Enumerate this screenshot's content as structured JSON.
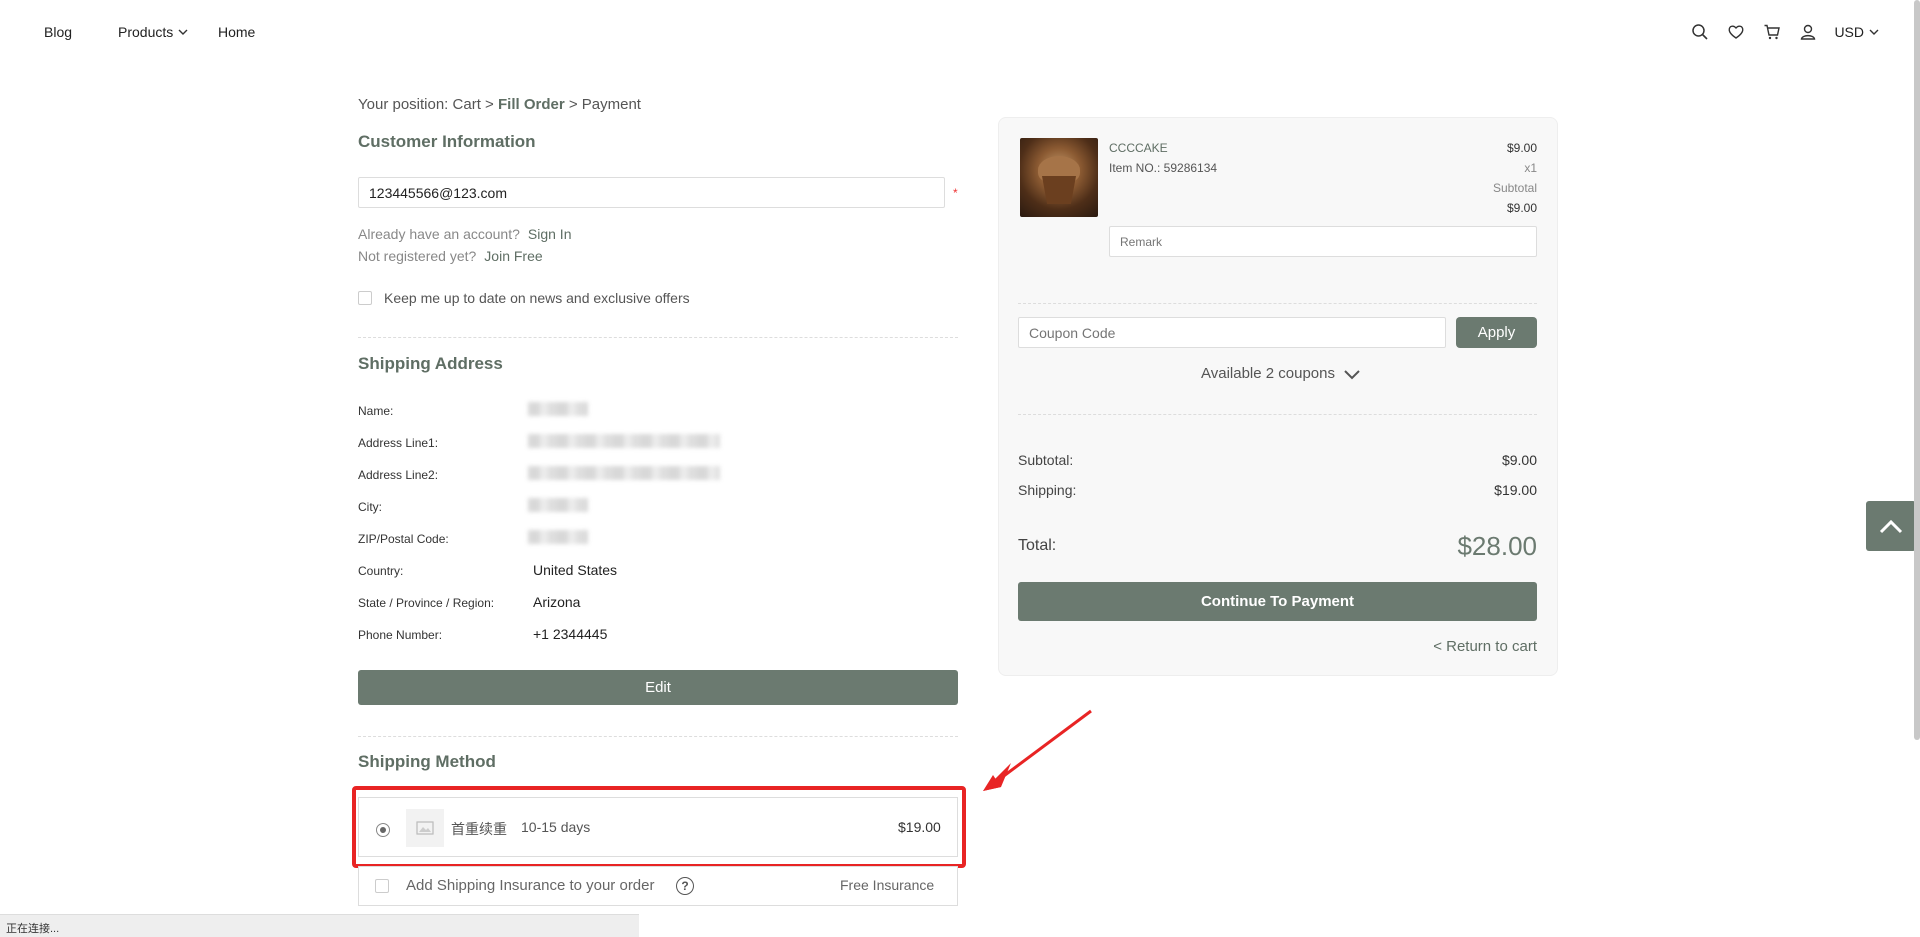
{
  "nav": {
    "blog": "Blog",
    "products": "Products",
    "home": "Home",
    "currency": "USD"
  },
  "breadcrumb": {
    "prefix": "Your position:",
    "cart": "Cart",
    "sep1": ">",
    "current": "Fill Order",
    "sep2": ">",
    "payment": "Payment"
  },
  "customer": {
    "title": "Customer Information",
    "email": "123445566@123.com",
    "required_mark": "*",
    "have_account": "Already have an account?",
    "sign_in": "Sign In",
    "not_registered": "Not registered yet?",
    "join_free": "Join Free",
    "newsletter_label": "Keep me up to date on news and exclusive offers"
  },
  "shipping_address": {
    "title": "Shipping Address",
    "labels": {
      "name": "Name:",
      "address1": "Address Line1:",
      "address2": "Address Line2:",
      "city": "City:",
      "zip": "ZIP/Postal Code:",
      "country": "Country:",
      "state": "State / Province / Region:",
      "phone": "Phone Number:"
    },
    "country": "United States",
    "state": "Arizona",
    "phone": "+1 2344445",
    "edit_label": "Edit"
  },
  "shipping_method": {
    "title": "Shipping Method",
    "option_name": "首重续重",
    "option_days": "10-15 days",
    "option_price": "$19.00",
    "insurance_label": "Add Shipping Insurance to your order",
    "insurance_help": "?",
    "insurance_value": "Free Insurance"
  },
  "summary": {
    "product_name": "CCCCAKE",
    "item_no": "Item NO.: 59286134",
    "unit_price": "$9.00",
    "quantity": "x1",
    "subtotal_caption": "Subtotal",
    "line_subtotal": "$9.00",
    "remark_placeholder": "Remark",
    "coupon_placeholder": "Coupon Code",
    "apply_label": "Apply",
    "available_coupons": "Available 2 coupons",
    "subtotal_label": "Subtotal:",
    "subtotal_value": "$9.00",
    "shipping_label": "Shipping:",
    "shipping_value": "$19.00",
    "total_label": "Total:",
    "total_value": "$28.00",
    "continue_label": "Continue To Payment",
    "return_label": "< Return to cart"
  },
  "status_bar": "正在连接...",
  "colors": {
    "accent": "#6b7a70",
    "highlight": "#e82424"
  }
}
